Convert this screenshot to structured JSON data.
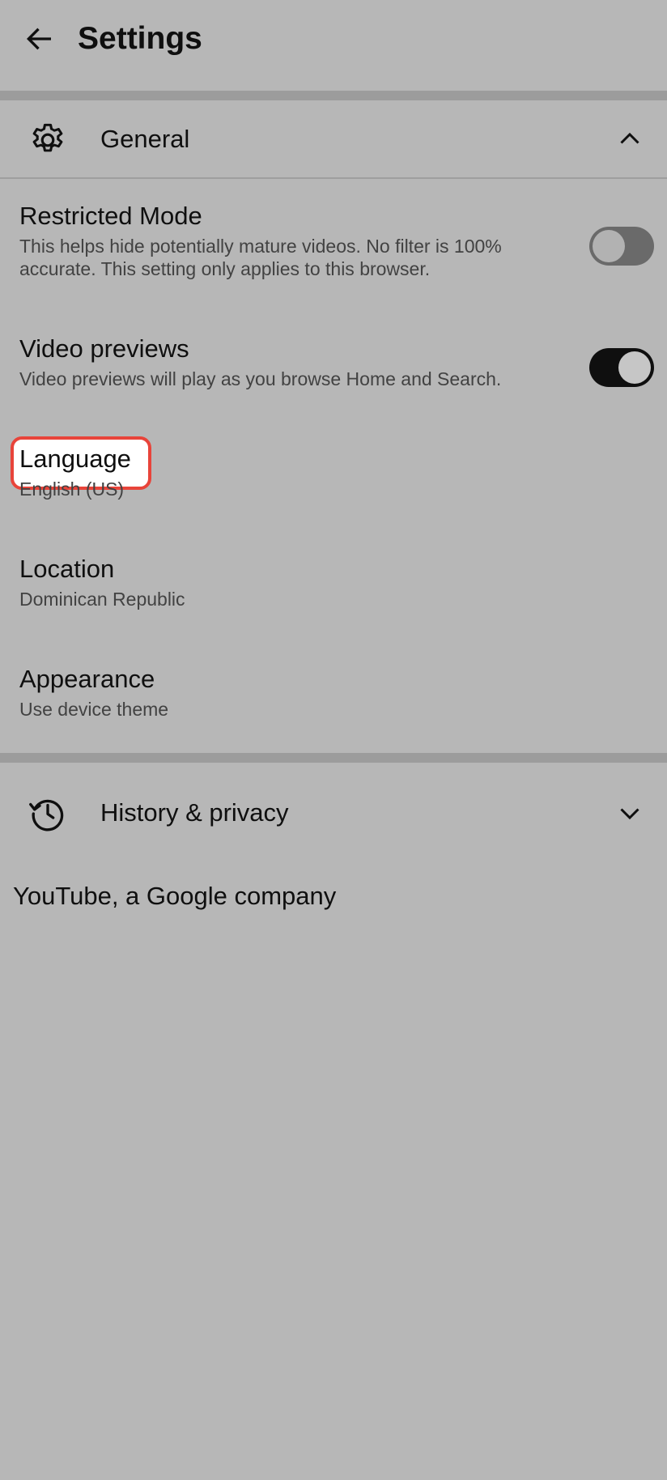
{
  "header": {
    "title": "Settings",
    "back_icon": "back-arrow-icon"
  },
  "sections": {
    "general": {
      "label": "General",
      "icon": "gear-icon",
      "expanded": true
    },
    "history": {
      "label": "History & privacy",
      "icon": "history-icon",
      "expanded": false
    }
  },
  "settings": {
    "restricted_mode": {
      "title": "Restricted Mode",
      "description": "This helps hide potentially mature videos. No filter is 100% accurate. This setting only applies to this browser.",
      "enabled": false
    },
    "video_previews": {
      "title": "Video previews",
      "description": "Video previews will play as you browse Home and Search.",
      "enabled": true
    },
    "language": {
      "title": "Language",
      "value": "English (US)"
    },
    "location": {
      "title": "Location",
      "value": "Dominican Republic"
    },
    "appearance": {
      "title": "Appearance",
      "value": "Use device theme"
    }
  },
  "footer": {
    "text": "YouTube, a Google company"
  },
  "colors": {
    "background": "#b7b7b7",
    "highlight_border": "#e8443a"
  }
}
